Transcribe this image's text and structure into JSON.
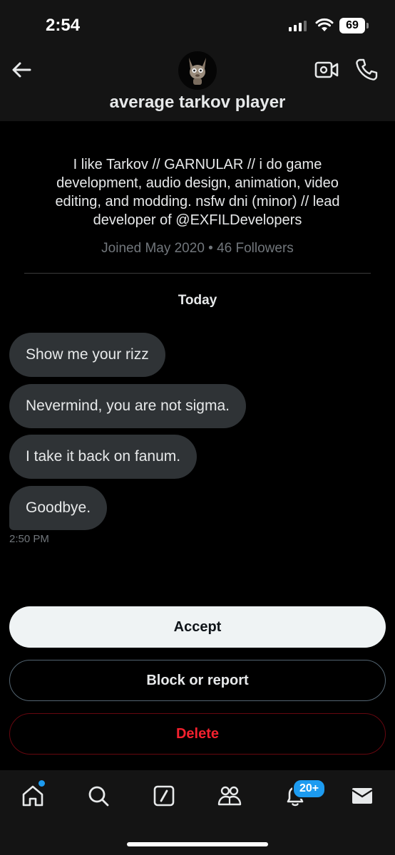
{
  "status_bar": {
    "time": "2:54",
    "battery": "69"
  },
  "header": {
    "display_name": "average tarkov player"
  },
  "profile": {
    "bio": "I like Tarkov // GARNULAR // i do game development, audio design, animation, video editing, and modding. nsfw dni (minor) // lead developer of @EXFILDevelopers",
    "meta": "Joined May 2020 • 46 Followers"
  },
  "conversation": {
    "day_label": "Today",
    "messages": [
      {
        "text": "Show me your rizz"
      },
      {
        "text": "Nevermind, you are not sigma."
      },
      {
        "text": "I take it back on fanum."
      },
      {
        "text": "Goodbye."
      }
    ],
    "timestamp": "2:50 PM"
  },
  "actions": {
    "accept": "Accept",
    "block_report": "Block or report",
    "delete": "Delete"
  },
  "bottom_nav": {
    "items": [
      "home-icon",
      "search-icon",
      "grok-icon",
      "communities-icon",
      "notifications-icon",
      "messages-icon"
    ],
    "notifications_badge": "20+"
  },
  "colors": {
    "accent": "#1d9bf0",
    "danger": "#f4212e",
    "bubble": "#2f3336"
  }
}
